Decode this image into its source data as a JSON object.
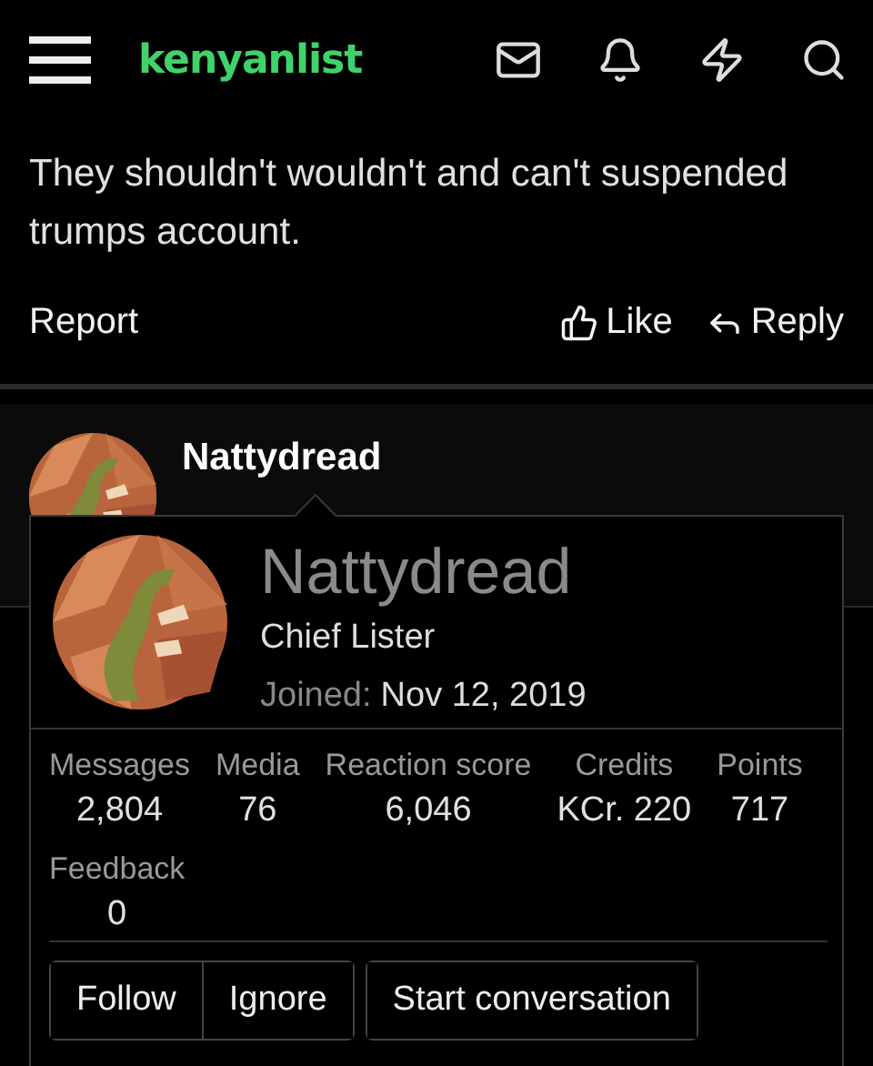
{
  "header": {
    "logo": "kenyanlist"
  },
  "post": {
    "text": "They shouldn't wouldn't and can't suspended trumps account.",
    "actions": {
      "report": "Report",
      "like": "Like",
      "reply": "Reply"
    }
  },
  "next_post": {
    "author": "Nattydread"
  },
  "member_card": {
    "name": "Nattydread",
    "title": "Chief Lister",
    "joined_label": "Joined:",
    "joined_date": "Nov 12, 2019",
    "stats": [
      {
        "label": "Messages",
        "value": "2,804"
      },
      {
        "label": "Media",
        "value": "76"
      },
      {
        "label": "Reaction score",
        "value": "6,046"
      },
      {
        "label": "Credits",
        "value": "KCr. 220"
      },
      {
        "label": "Points",
        "value": "717"
      },
      {
        "label": "Feedback",
        "value": "0"
      }
    ],
    "button_groups": [
      [
        "Follow",
        "Ignore"
      ],
      [
        "Start conversation"
      ]
    ]
  }
}
